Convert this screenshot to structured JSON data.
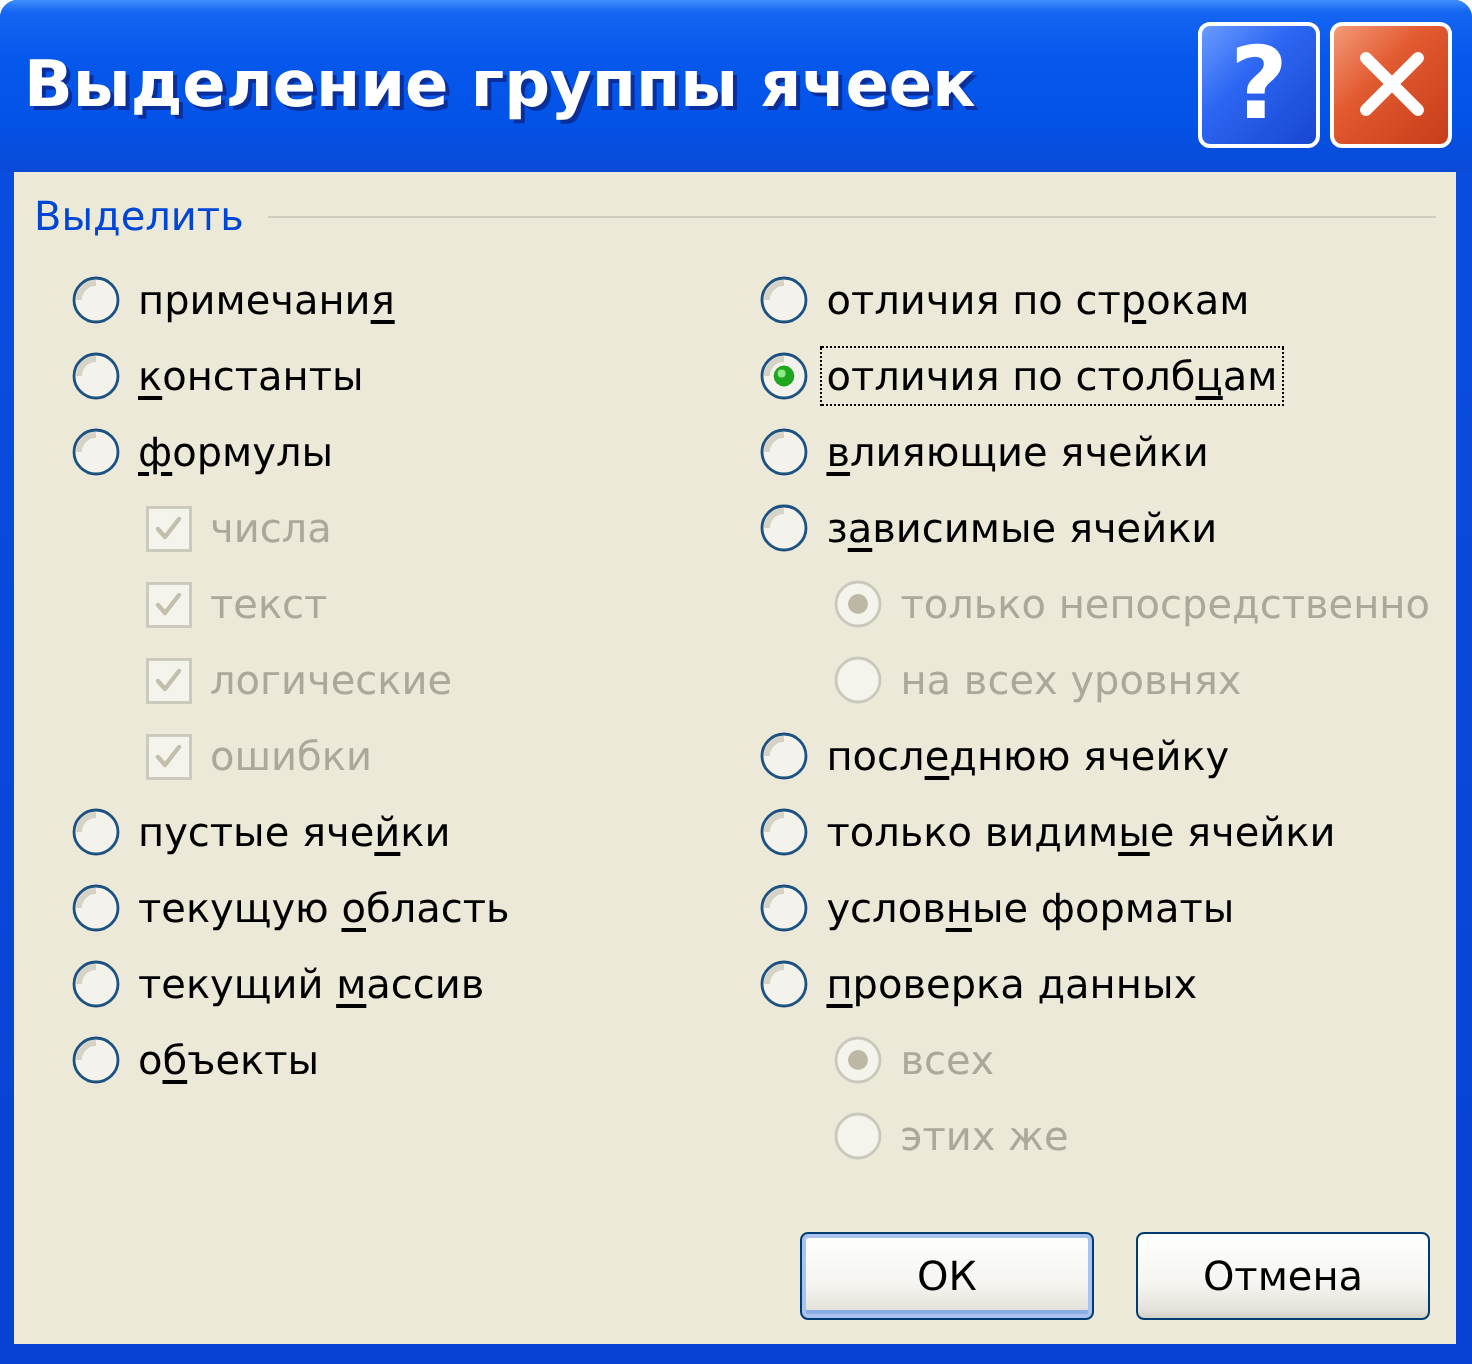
{
  "window": {
    "title": "Выделение группы ячеек",
    "controls": [
      {
        "kind": "help",
        "label": "?"
      },
      {
        "kind": "close"
      }
    ]
  },
  "group": {
    "legend": "Выделить",
    "columns": [
      {
        "options": [
          {
            "kind": "radio",
            "label": [
              {
                "text": "примечани",
                "underlined": false
              },
              {
                "text": "я",
                "underlined": true
              }
            ],
            "selected": false,
            "disabled": false,
            "focused": false
          },
          {
            "kind": "radio",
            "label": [
              {
                "text": "к",
                "underlined": true
              },
              {
                "text": "онстанты",
                "underlined": false
              }
            ],
            "selected": false,
            "disabled": false,
            "focused": false
          },
          {
            "kind": "radio",
            "label": [
              {
                "text": "ф",
                "underlined": true
              },
              {
                "text": "ормулы",
                "underlined": false
              }
            ],
            "selected": false,
            "disabled": false,
            "focused": false,
            "children": [
              {
                "kind": "checkbox",
                "label": [
                  {
                    "text": "числа",
                    "underlined": false
                  }
                ],
                "checked": true,
                "disabled": true
              },
              {
                "kind": "checkbox",
                "label": [
                  {
                    "text": "текст",
                    "underlined": false
                  }
                ],
                "checked": true,
                "disabled": true
              },
              {
                "kind": "checkbox",
                "label": [
                  {
                    "text": "логические",
                    "underlined": false
                  }
                ],
                "checked": true,
                "disabled": true
              },
              {
                "kind": "checkbox",
                "label": [
                  {
                    "text": "ошибки",
                    "underlined": false
                  }
                ],
                "checked": true,
                "disabled": true
              }
            ]
          },
          {
            "kind": "radio",
            "label": [
              {
                "text": "пустые яче",
                "underlined": false
              },
              {
                "text": "й",
                "underlined": true
              },
              {
                "text": "ки",
                "underlined": false
              }
            ],
            "selected": false,
            "disabled": false,
            "focused": false
          },
          {
            "kind": "radio",
            "label": [
              {
                "text": "текущую ",
                "underlined": false
              },
              {
                "text": "о",
                "underlined": true
              },
              {
                "text": "бласть",
                "underlined": false
              }
            ],
            "selected": false,
            "disabled": false,
            "focused": false
          },
          {
            "kind": "radio",
            "label": [
              {
                "text": "текущий ",
                "underlined": false
              },
              {
                "text": "м",
                "underlined": true
              },
              {
                "text": "ассив",
                "underlined": false
              }
            ],
            "selected": false,
            "disabled": false,
            "focused": false
          },
          {
            "kind": "radio",
            "label": [
              {
                "text": "о",
                "underlined": false
              },
              {
                "text": "б",
                "underlined": true
              },
              {
                "text": "ъекты",
                "underlined": false
              }
            ],
            "selected": false,
            "disabled": false,
            "focused": false
          }
        ]
      },
      {
        "options": [
          {
            "kind": "radio",
            "label": [
              {
                "text": "отличия по ст",
                "underlined": false
              },
              {
                "text": "р",
                "underlined": true
              },
              {
                "text": "окам",
                "underlined": false
              }
            ],
            "selected": false,
            "disabled": false,
            "focused": false
          },
          {
            "kind": "radio",
            "label": [
              {
                "text": "отличия по столб",
                "underlined": false
              },
              {
                "text": "ц",
                "underlined": true
              },
              {
                "text": "ам",
                "underlined": false
              }
            ],
            "selected": true,
            "disabled": false,
            "focused": true
          },
          {
            "kind": "radio",
            "label": [
              {
                "text": "в",
                "underlined": true
              },
              {
                "text": "лияющие ячейки",
                "underlined": false
              }
            ],
            "selected": false,
            "disabled": false,
            "focused": false
          },
          {
            "kind": "radio",
            "label": [
              {
                "text": "з",
                "underlined": false
              },
              {
                "text": "а",
                "underlined": true
              },
              {
                "text": "висимые ячейки",
                "underlined": false
              }
            ],
            "selected": false,
            "disabled": false,
            "focused": false,
            "children": [
              {
                "kind": "radio",
                "label": [
                  {
                    "text": "только непосредственно",
                    "underlined": false
                  }
                ],
                "selected": true,
                "disabled": true
              },
              {
                "kind": "radio",
                "label": [
                  {
                    "text": "на всех уровнях",
                    "underlined": false
                  }
                ],
                "selected": false,
                "disabled": true
              }
            ]
          },
          {
            "kind": "radio",
            "label": [
              {
                "text": "посл",
                "underlined": false
              },
              {
                "text": "е",
                "underlined": true
              },
              {
                "text": "днюю ячейку",
                "underlined": false
              }
            ],
            "selected": false,
            "disabled": false,
            "focused": false
          },
          {
            "kind": "radio",
            "label": [
              {
                "text": "только видим",
                "underlined": false
              },
              {
                "text": "ы",
                "underlined": true
              },
              {
                "text": "е ячейки",
                "underlined": false
              }
            ],
            "selected": false,
            "disabled": false,
            "focused": false
          },
          {
            "kind": "radio",
            "label": [
              {
                "text": "услов",
                "underlined": false
              },
              {
                "text": "н",
                "underlined": true
              },
              {
                "text": "ые форматы",
                "underlined": false
              }
            ],
            "selected": false,
            "disabled": false,
            "focused": false
          },
          {
            "kind": "radio",
            "label": [
              {
                "text": "п",
                "underlined": true
              },
              {
                "text": "роверка данных",
                "underlined": false
              }
            ],
            "selected": false,
            "disabled": false,
            "focused": false,
            "children": [
              {
                "kind": "radio",
                "label": [
                  {
                    "text": "всех",
                    "underlined": false
                  }
                ],
                "selected": true,
                "disabled": true
              },
              {
                "kind": "radio",
                "label": [
                  {
                    "text": "этих же",
                    "underlined": false
                  }
                ],
                "selected": false,
                "disabled": true
              }
            ]
          }
        ]
      }
    ]
  },
  "buttons": [
    {
      "label": "ОК",
      "default": true
    },
    {
      "label": "Отмена",
      "default": false
    }
  ]
}
